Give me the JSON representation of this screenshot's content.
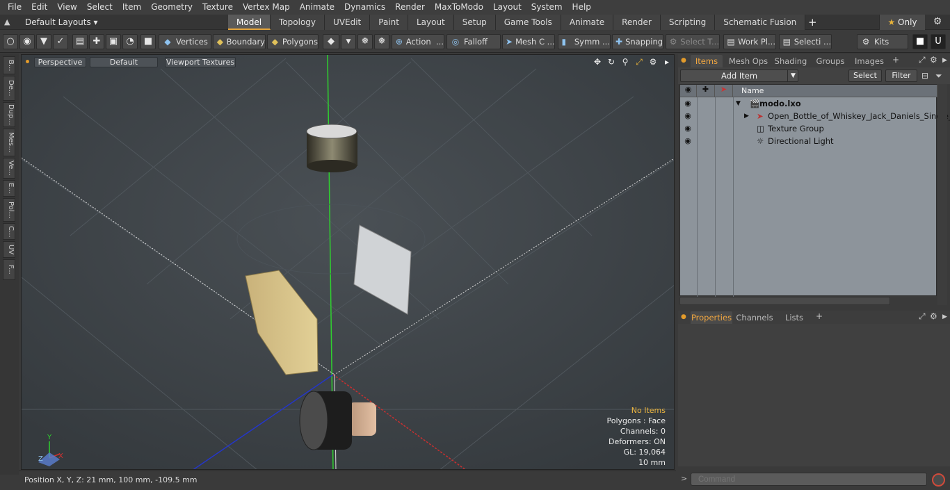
{
  "menubar": [
    "File",
    "Edit",
    "View",
    "Select",
    "Item",
    "Geometry",
    "Texture",
    "Vertex Map",
    "Animate",
    "Dynamics",
    "Render",
    "MaxToModo",
    "Layout",
    "System",
    "Help"
  ],
  "layout": {
    "selector": "Default Layouts ▾",
    "tabs": [
      "Model",
      "Topology",
      "UVEdit",
      "Paint",
      "Layout",
      "Setup",
      "Game Tools",
      "Animate",
      "Render",
      "Scripting",
      "Schematic Fusion"
    ],
    "active_tab": "Model",
    "only": "Only"
  },
  "toolbar": {
    "vertices": "Vertices",
    "boundary": "Boundary",
    "polygons": "Polygons",
    "action": "Action",
    "falloff": "Falloff",
    "mesh_c": "Mesh C ...",
    "symm": "Symm ...",
    "snapping": "Snapping",
    "select_t": "Select T...",
    "work_pl": "Work Pl...",
    "selecti": "Selecti ...",
    "kits": "Kits"
  },
  "left_tabs": [
    "B...",
    "De...",
    "Dup...",
    "Mes...",
    "Ve...",
    "E...",
    "Pol...",
    "C...",
    "UV",
    "F..."
  ],
  "viewport": {
    "perspective": "Perspective",
    "default": "Default",
    "textures": "Viewport Textures",
    "stats": {
      "items": "No Items",
      "polygons": "Polygons : Face",
      "channels": "Channels: 0",
      "deformers": "Deformers: ON",
      "gl": "GL: 19,064",
      "scale": "10 mm"
    },
    "axis_x": "X",
    "axis_y": "Y",
    "axis_z": "Z"
  },
  "status": {
    "position": "Position X, Y, Z:   21 mm, 100 mm, -109.5 mm"
  },
  "items_panel": {
    "tabs": [
      "Items",
      "Mesh Ops",
      "Shading",
      "Groups",
      "Images"
    ],
    "active_tab": "Items",
    "add_item": "Add Item",
    "select": "Select",
    "filter": "Filter",
    "name_col": "Name",
    "rows": [
      {
        "label": "modo.lxo",
        "indent": 0
      },
      {
        "label": "Open_Bottle_of_Whiskey_Jack_Daniels_Single_...",
        "indent": 1
      },
      {
        "label": "Texture Group",
        "indent": 1
      },
      {
        "label": "Directional Light",
        "indent": 1
      }
    ]
  },
  "properties_panel": {
    "tabs": [
      "Properties",
      "Channels",
      "Lists"
    ],
    "active_tab": "Properties"
  },
  "command": {
    "placeholder": "Command"
  },
  "colors": {
    "accent": "#e5a43a",
    "viewport_bg": "#3f454a",
    "items_bg": "#8d949b"
  }
}
